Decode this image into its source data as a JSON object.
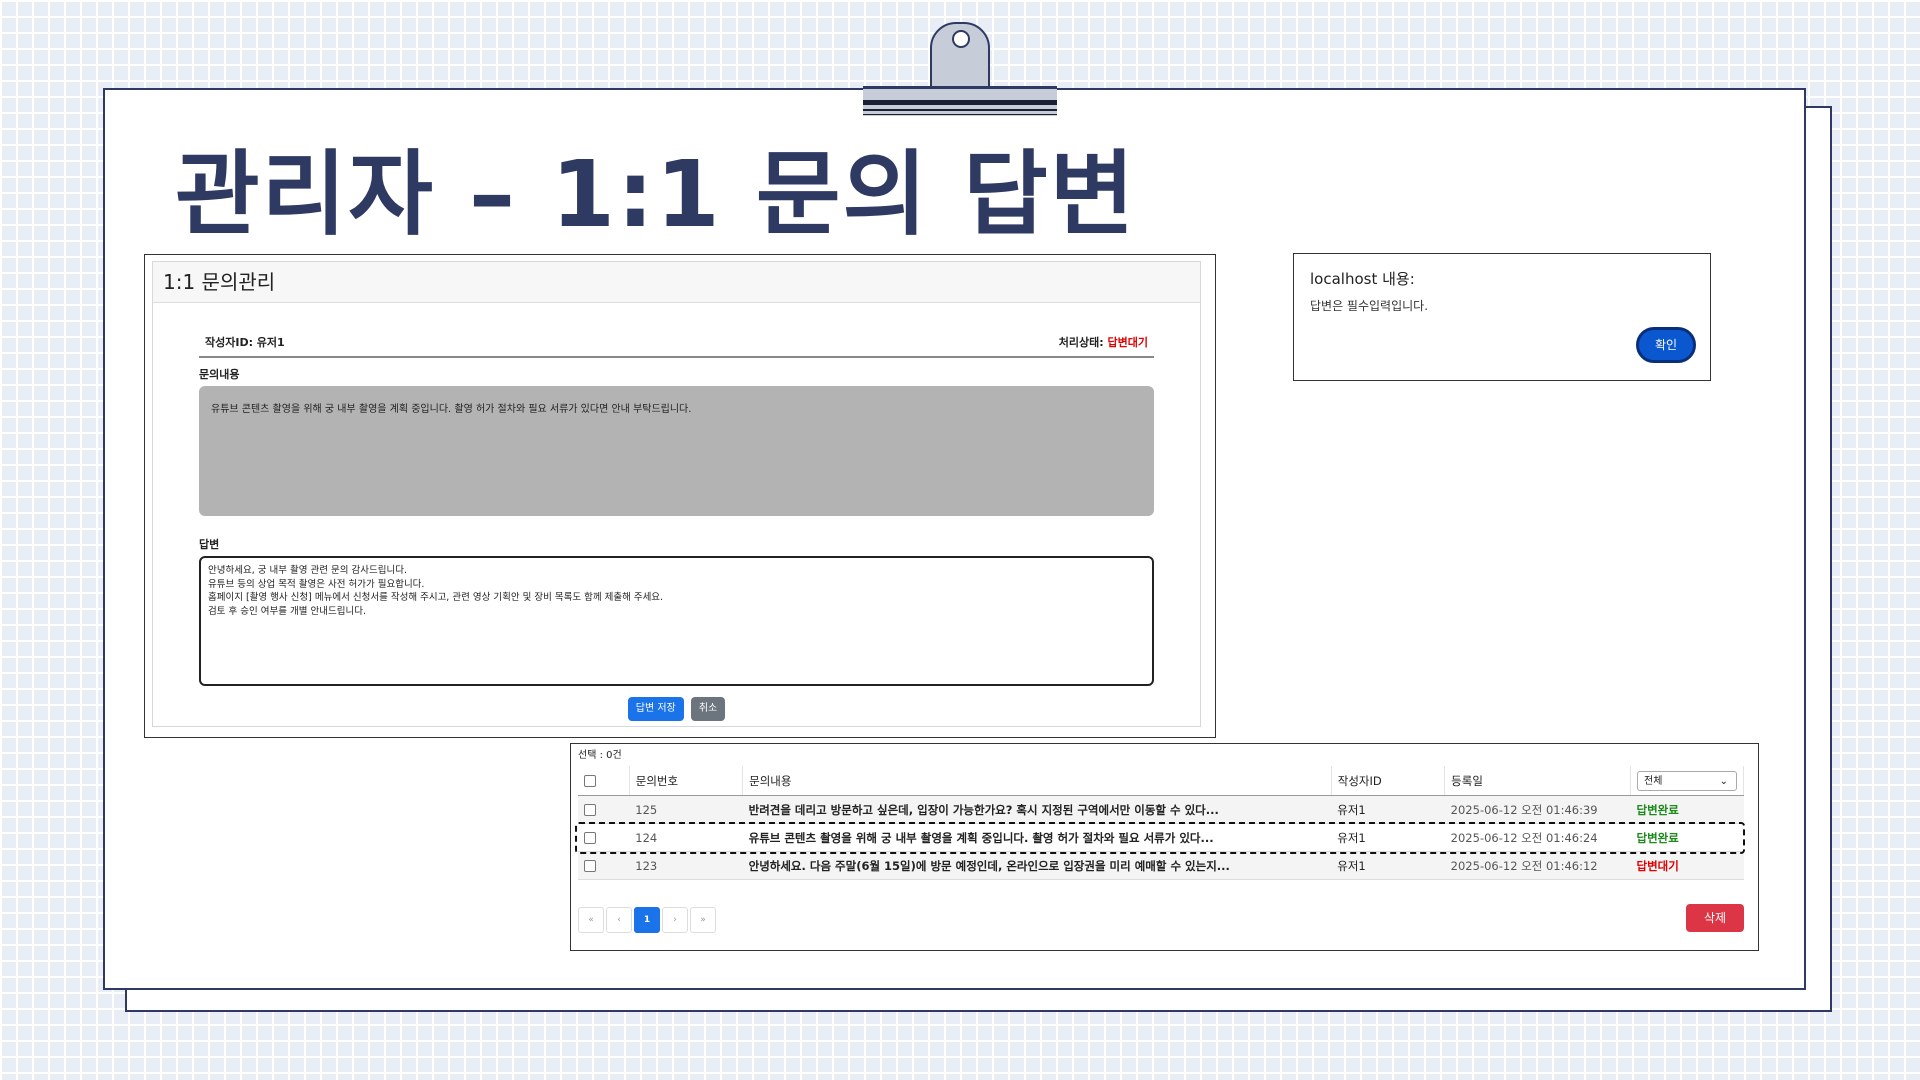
{
  "slide_title": "관리자 – 1:1 문의 답변",
  "detail": {
    "header": "1:1 문의관리",
    "author_label": "작성자ID: 유저1",
    "status_label": "처리상태: ",
    "status_value": "답변대기",
    "content_label": "문의내용",
    "content_text": "유튜브 콘텐츠 촬영을 위해 궁 내부 촬영을 계획 중입니다. 촬영 허가 절차와 필요 서류가 있다면 안내 부탁드립니다.",
    "answer_label": "답변",
    "answer_text": "안녕하세요, 궁 내부 촬영 관련 문의 감사드립니다.\n유튜브 등의 상업 목적 촬영은 사전 허가가 필요합니다.\n홈페이지 [촬영 행사 신청] 메뉴에서 신청서를 작성해 주시고, 관련 영상 기획안 및 장비 목록도 함께 제출해 주세요.\n검토 후 승인 여부를 개별 안내드립니다.",
    "save_button": "답변 저장",
    "cancel_button": "취소"
  },
  "alert": {
    "title": "localhost 내용:",
    "message": "답변은 필수입력입니다.",
    "ok_button": "확인"
  },
  "list": {
    "selected_count": "선택 : 0건",
    "columns": [
      "문의번호",
      "문의내용",
      "작성자ID",
      "등록일"
    ],
    "filter_value": "전체",
    "rows": [
      {
        "no": "125",
        "content": "반려견을 데리고 방문하고 싶은데, 입장이 가능한가요? 혹시 지정된 구역에서만 이동할 수 있다...",
        "author": "유저1",
        "date": "2025-06-12 오전 01:46:39",
        "status": "답변완료"
      },
      {
        "no": "124",
        "content": "유튜브 콘텐츠 촬영을 위해 궁 내부 촬영을 계획 중입니다. 촬영 허가 절차와 필요 서류가 있다...",
        "author": "유저1",
        "date": "2025-06-12 오전 01:46:24",
        "status": "답변완료"
      },
      {
        "no": "123",
        "content": "안녕하세요. 다음 주말(6월 15일)에 방문 예정인데, 온라인으로 입장권을 미리 예매할 수 있는지...",
        "author": "유저1",
        "date": "2025-06-12 오전 01:46:12",
        "status": "답변대기"
      }
    ],
    "pager": {
      "first": "«",
      "prev": "‹",
      "current": "1",
      "next": "›",
      "last": "»"
    },
    "delete_button": "삭제"
  },
  "colors": {
    "title": "#2f3a63",
    "primary": "#1a73e8",
    "danger": "#dc3545",
    "done": "#1a8a1a",
    "wait": "#e00000"
  }
}
